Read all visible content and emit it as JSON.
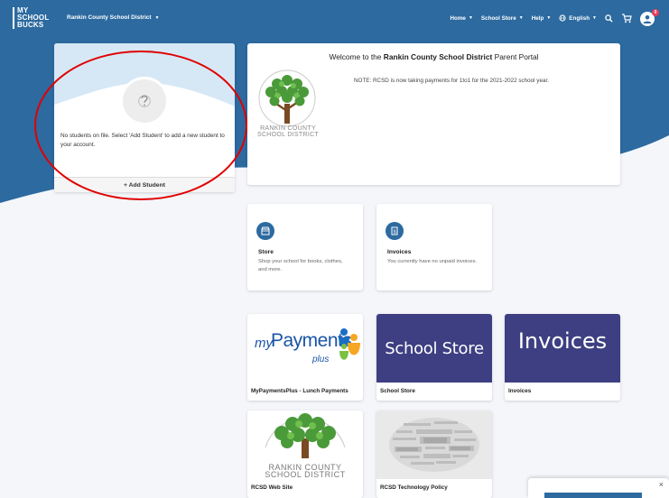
{
  "nav": {
    "logo_lines": [
      "MY",
      "SCHOOL",
      "BUCKS"
    ],
    "district": "Rankin County School District",
    "items": [
      {
        "label": "Home"
      },
      {
        "label": "School Store"
      },
      {
        "label": "Help"
      },
      {
        "label": "English"
      }
    ],
    "cart_badge": "0",
    "icons": [
      "search-icon",
      "cart-icon",
      "globe-icon",
      "avatar-icon"
    ]
  },
  "student_card": {
    "message": "No students on file. Select 'Add Student' to add a new student to your account.",
    "add_label": "+ Add Student"
  },
  "welcome": {
    "prefix": "Welcome to the ",
    "district": "Rankin County School District",
    "suffix": " Parent Portal",
    "note": "NOTE: RCSD is now taking payments for 1to1 for the 2021-2022 school year.",
    "logo_text": [
      "RANKIN COUNTY",
      "SCHOOL DISTRICT"
    ]
  },
  "actions": [
    {
      "title": "Store",
      "description": "Shop your school for books, clothes, and more.",
      "icon": "store-icon"
    },
    {
      "title": "Invoices",
      "description": "You currently have no unpaid invoices.",
      "icon": "invoice-icon"
    }
  ],
  "tiles": [
    {
      "label": "MyPaymentsPlus - Lunch Payments",
      "image_text": [
        "my",
        "Payments",
        "plus"
      ]
    },
    {
      "label": "School Store",
      "image_text": "School Store"
    },
    {
      "label": "Invoices",
      "image_text": "Invoices"
    },
    {
      "label": "RCSD Web Site",
      "image_text": [
        "RANKIN COUNTY",
        "SCHOOL DISTRICT"
      ]
    },
    {
      "label": "RCSD Technology Policy"
    }
  ],
  "chat": {
    "close_label": "×"
  },
  "colors": {
    "hero_blue": "#2c6aa0",
    "card_purple": "#3d3f82",
    "annotation_red": "#e00000",
    "badge_pink": "#e83c5a"
  }
}
